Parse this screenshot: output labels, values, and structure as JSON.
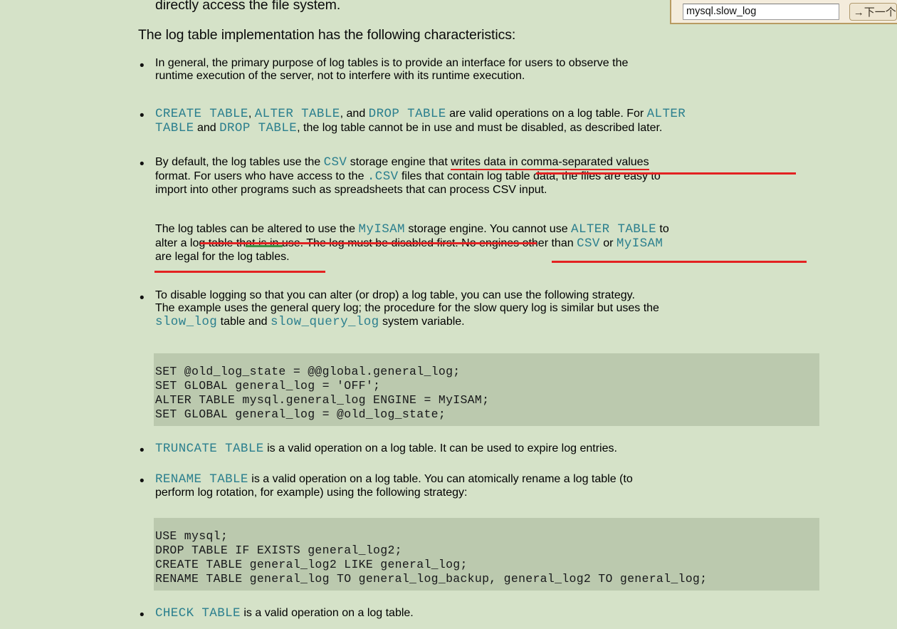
{
  "theme": {
    "page_background": "#d5e2c8",
    "code_block_background": "#bbc9ae",
    "code_text_color": "#2b7f8e",
    "annotation_red": "#e32222",
    "annotation_green": "#3c8f45",
    "toolbar_background": "#f4ecdc",
    "toolbar_border": "#b89b62"
  },
  "find_toolbar": {
    "input_value": "mysql.slow_log",
    "input_placeholder": "",
    "next_button_label": "→下一个"
  },
  "document": {
    "intro_fragment": "directly access the file system.",
    "lead_paragraph": "The log table implementation has the following characteristics:",
    "bullets": [
      {
        "id": "purpose",
        "lines": [
          "In general, the primary purpose of log tables is to provide an interface for users to observe the",
          "runtime execution of the server, not to interfere with its runtime execution."
        ]
      },
      {
        "id": "ddl-operations",
        "line1_part1_code": "CREATE TABLE",
        "line1_part2": ", ",
        "line1_part3_code": "ALTER TABLE",
        "line1_part4": ", and ",
        "line1_part5_code": "DROP TABLE",
        "line1_part6": " are valid operations on a log table. For ",
        "line1_part7_code": "ALTER",
        "line2_part1_code": "TABLE",
        "line2_part2": " and ",
        "line2_part3_code": "DROP TABLE",
        "line2_part4": ", the log table cannot be in use and must be disabled, as described later."
      },
      {
        "id": "csv-engine",
        "line1_part1": "By default, the log tables use the ",
        "line1_part2_code": "CSV",
        "line1_part3": " storage engine that ",
        "line1_part4_underlined": "writes data in comma-separated values",
        "line2_part1": "format. For users who have access to the ",
        "line2_part2_code": ".CSV",
        "line2_part3": " files that ",
        "line2_part4_underlined": "contain log table data, the files are easy to",
        "line3": "import into other programs such as spreadsheets that can process CSV input."
      }
    ],
    "myisam_paragraph": {
      "line1_part1": "The log tables ",
      "line1_part2_underlined": "can be altered to use the ",
      "line1_part3_code_underlined": "MyISAM",
      "line1_part4_underlined": " storage engine",
      "line1_part5": ". You cannot use ",
      "line1_part6_code": "ALTER TABLE",
      "line1_part7": " to",
      "line2_part1": "alter a log table that is in use. The log must be disabled first. ",
      "line2_part2_underlined": "No engines other than ",
      "line2_part3_code_underlined": "CSV",
      "line2_part4_underlined": " or ",
      "line2_part5_code_underlined": "MyISAM",
      "line3_part1_underlined": "are legal for the log tables",
      "line3_part2": "."
    },
    "disable_logging_bullet": {
      "line1": "To disable logging so that you can alter (or drop) a log table, you can use the following strategy.",
      "line2": "The example uses the general query log; the procedure for the slow query log is similar but uses the",
      "line3_part1_code": "slow_log",
      "line3_part2": " table and ",
      "line3_part3_code": "slow_query_log",
      "line3_part4": " system variable."
    },
    "code_block_1": "SET @old_log_state = @@global.general_log;\nSET GLOBAL general_log = 'OFF';\nALTER TABLE mysql.general_log ENGINE = MyISAM;\nSET GLOBAL general_log = @old_log_state;",
    "truncate_bullet": {
      "code": "TRUNCATE TABLE",
      "text": " is a valid operation on a log table. It can be used to expire log entries."
    },
    "rename_bullet": {
      "code": "RENAME TABLE",
      "line1_text": " is a valid operation on a log table. You can atomically rename a log table (to",
      "line2_text": "perform log rotation, for example) using the following strategy:"
    },
    "code_block_2": "USE mysql;\nDROP TABLE IF EXISTS general_log2;\nCREATE TABLE general_log2 LIKE general_log;\nRENAME TABLE general_log TO general_log_backup, general_log2 TO general_log;",
    "check_bullet": {
      "code": "CHECK TABLE",
      "text": " is a valid operation on a log table."
    },
    "bullet_glyph": "•"
  }
}
